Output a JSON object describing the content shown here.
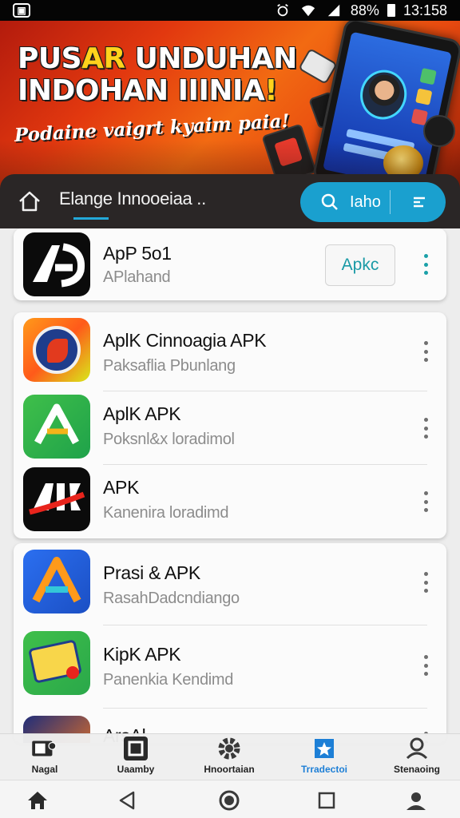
{
  "status_bar": {
    "battery_percent": "88%",
    "time": "13:158"
  },
  "banner": {
    "title_line1_a": "PUS",
    "title_line1_b": "AR",
    "title_line1_c": " UNDUHAN",
    "title_line2_a": "INDOHAN IIINIA",
    "title_line2_b": "!",
    "subtitle": "Podaine vaigrt kyaim paia!"
  },
  "search_row": {
    "address_text": "Elange Innooeiaa ..",
    "search_label": "Iaho"
  },
  "featured": {
    "name": "ApP 5o1",
    "sub": "APlahand",
    "button_label": "Apkc"
  },
  "list1": [
    {
      "name": "AplK Cinnoagia APK",
      "sub": "Paksaflia Pbunlang"
    },
    {
      "name": "AplK APK",
      "sub": "Poksnl&x loradimol"
    },
    {
      "name": "APK",
      "sub": "Kanenira loradimd"
    }
  ],
  "list2": [
    {
      "name": "Prasi & APK",
      "sub": "RasahDadcndiango"
    },
    {
      "name": "KipK APK",
      "sub": "Panenkia Kendimd"
    },
    {
      "name": "ArsAl"
    }
  ],
  "tabs": [
    {
      "label": "Nagal",
      "icon": "gallery-icon"
    },
    {
      "label": "Uaamby",
      "icon": "square-app-icon"
    },
    {
      "label": "Hnoortaian",
      "icon": "gear-icon"
    },
    {
      "label": "Trradectoi",
      "icon": "star-badge-icon"
    },
    {
      "label": "Stenaoing",
      "icon": "person-icon"
    }
  ],
  "colors": {
    "accent": "#1aa0cf",
    "active_tab": "#1d7fd6",
    "banner_accent": "#ffd21c"
  }
}
